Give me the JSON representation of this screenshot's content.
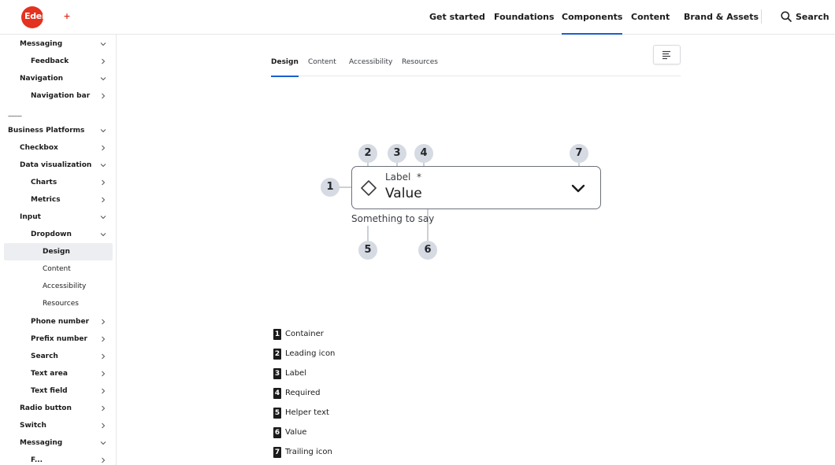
{
  "header": {
    "logo_text": "Edenred",
    "logo_plus": "+",
    "nav": [
      {
        "label": "Get started",
        "active": false
      },
      {
        "label": "Foundations",
        "active": false
      },
      {
        "label": "Components",
        "active": true
      },
      {
        "label": "Content",
        "active": false
      },
      {
        "label": "Brand & Assets",
        "active": false
      }
    ],
    "search_label": "Search",
    "accent": "#1a5fcf",
    "brand_color": "#e3321f"
  },
  "sidebar": {
    "separator": "---------",
    "items": [
      {
        "label": "Messaging",
        "level": 1,
        "chevron": "down"
      },
      {
        "label": "Feedback",
        "level": 2,
        "chevron": "right"
      },
      {
        "label": "Navigation",
        "level": 1,
        "chevron": "down"
      },
      {
        "label": "Navigation bar",
        "level": 2,
        "chevron": "right"
      },
      {
        "label": "Business Platforms",
        "level": 0,
        "chevron": "down"
      },
      {
        "label": "Checkbox",
        "level": 1,
        "chevron": "right"
      },
      {
        "label": "Data visualization",
        "level": 1,
        "chevron": "down"
      },
      {
        "label": "Charts",
        "level": 2,
        "chevron": "right"
      },
      {
        "label": "Metrics",
        "level": 2,
        "chevron": "right"
      },
      {
        "label": "Input",
        "level": 1,
        "chevron": "down"
      },
      {
        "label": "Dropdown",
        "level": 2,
        "chevron": "down"
      },
      {
        "label": "Design",
        "level": 3,
        "chevron": "",
        "selected": true
      },
      {
        "label": "Content",
        "level": 3,
        "chevron": ""
      },
      {
        "label": "Accessibility",
        "level": 3,
        "chevron": ""
      },
      {
        "label": "Resources",
        "level": 3,
        "chevron": ""
      },
      {
        "label": "Phone number",
        "level": 2,
        "chevron": "right"
      },
      {
        "label": "Prefix number",
        "level": 2,
        "chevron": "right"
      },
      {
        "label": "Search",
        "level": 2,
        "chevron": "right"
      },
      {
        "label": "Text area",
        "level": 2,
        "chevron": "right"
      },
      {
        "label": "Text field",
        "level": 2,
        "chevron": "right"
      },
      {
        "label": "Radio button",
        "level": 1,
        "chevron": "right"
      },
      {
        "label": "Switch",
        "level": 1,
        "chevron": "right"
      },
      {
        "label": "Messaging",
        "level": 1,
        "chevron": "down"
      },
      {
        "label": "F...",
        "level": 2,
        "chevron": "right"
      }
    ]
  },
  "tabs": [
    {
      "label": "Design",
      "active": true
    },
    {
      "label": "Content",
      "active": false
    },
    {
      "label": "Accessibility",
      "active": false
    },
    {
      "label": "Resources",
      "active": false
    }
  ],
  "toc_icon": "table-of-contents-icon",
  "anatomy": {
    "label_text": "Label",
    "required_mark": "*",
    "value_text": "Value",
    "helper_text": "Something to say",
    "badges": [
      "1",
      "2",
      "3",
      "4",
      "5",
      "6",
      "7"
    ],
    "leading_icon": "diamond-icon",
    "trailing_icon": "chevron-down-icon"
  },
  "legend": [
    {
      "num": "1",
      "text": "Container"
    },
    {
      "num": "2",
      "text": "Leading icon"
    },
    {
      "num": "3",
      "text": "Label"
    },
    {
      "num": "4",
      "text": "Required"
    },
    {
      "num": "5",
      "text": "Helper text"
    },
    {
      "num": "6",
      "text": "Value"
    },
    {
      "num": "7",
      "text": "Trailing icon"
    }
  ]
}
